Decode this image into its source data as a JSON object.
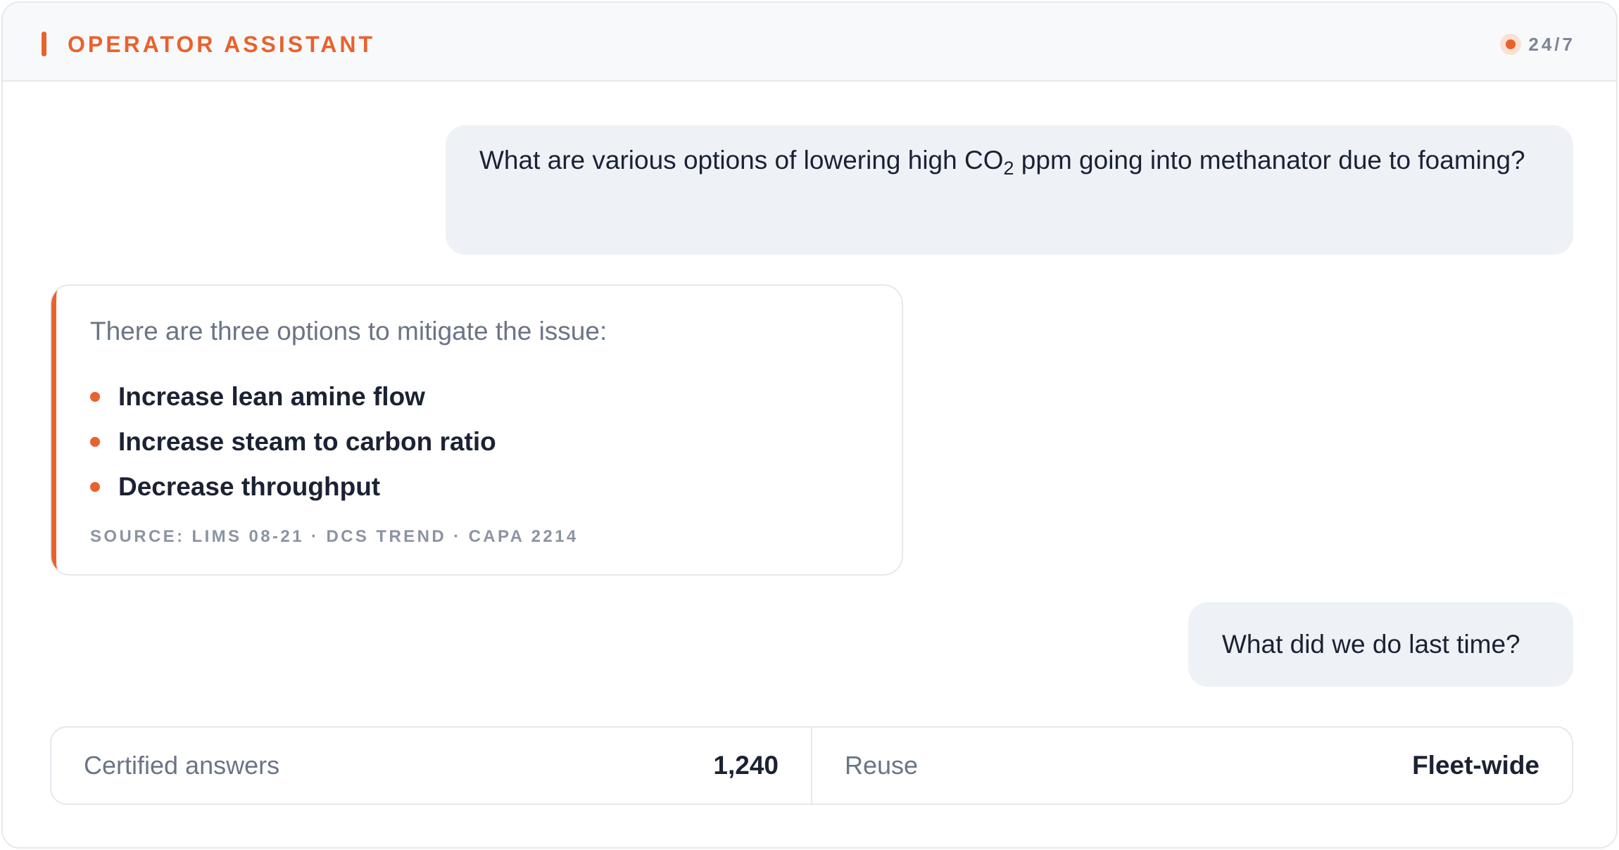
{
  "header": {
    "title": "OPERATOR ASSISTANT",
    "status_text": "24/7",
    "accent_color": "#e8622e"
  },
  "messages": {
    "user_1": {
      "text_before": "What are various options of lowering high CO",
      "subscript": "2",
      "text_after": " ppm going into methanator due to foaming?"
    },
    "assistant_1": {
      "intro": "There are three options to mitigate the issue:",
      "options": [
        "Increase lean amine flow",
        "Increase steam to carbon ratio",
        "Decrease throughput"
      ],
      "source": "SOURCE: LIMS 08-21 · DCS TREND · CAPA 2214"
    },
    "user_2": {
      "text": "What did we do last time?"
    }
  },
  "stats": [
    {
      "label": "Certified answers",
      "value": "1,240"
    },
    {
      "label": "Reuse",
      "value": "Fleet-wide"
    }
  ]
}
